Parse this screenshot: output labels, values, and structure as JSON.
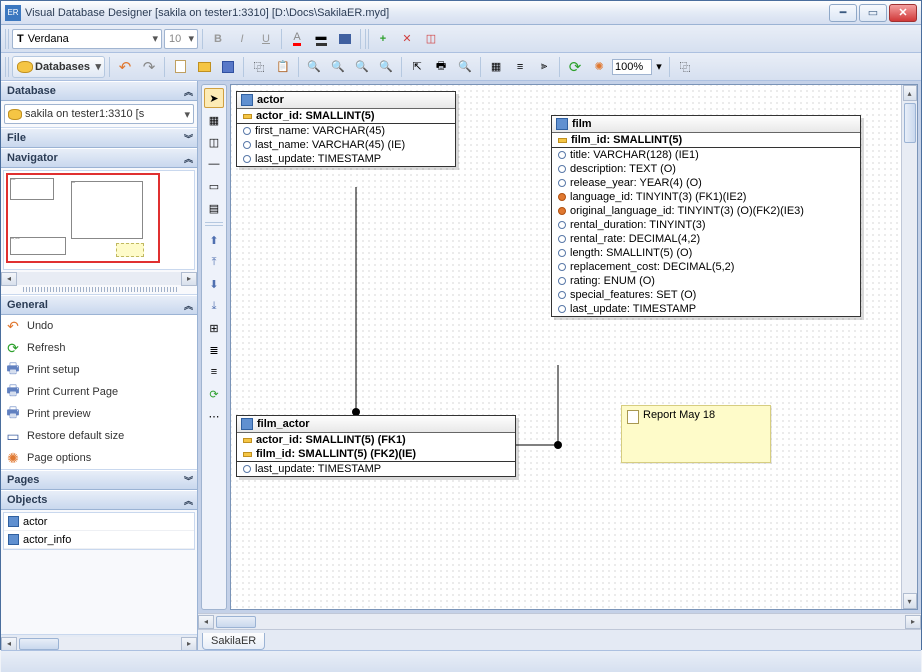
{
  "window": {
    "title": "Visual Database Designer [sakila on tester1:3310] [D:\\Docs\\SakilaER.myd]"
  },
  "toolbar1": {
    "font": "Verdana",
    "size": "10",
    "zoom": "100%"
  },
  "toolbar2": {
    "databases_label": "Databases"
  },
  "panels": {
    "database": {
      "title": "Database",
      "connection": "sakila on tester1:3310 [s"
    },
    "file": {
      "title": "File"
    },
    "navigator": {
      "title": "Navigator"
    },
    "general": {
      "title": "General",
      "items": [
        {
          "label": "Undo",
          "icon": "undo-icon",
          "color": "#E07830"
        },
        {
          "label": "Refresh",
          "icon": "refresh-icon",
          "color": "#2DA02D"
        },
        {
          "label": "Print setup",
          "icon": "print-setup-icon",
          "color": "#6080C0"
        },
        {
          "label": "Print Current Page",
          "icon": "print-page-icon",
          "color": "#6080C0"
        },
        {
          "label": "Print preview",
          "icon": "print-preview-icon",
          "color": "#6080C0"
        },
        {
          "label": "Restore default size",
          "icon": "restore-size-icon",
          "color": "#4060A0"
        },
        {
          "label": "Page options",
          "icon": "page-options-icon",
          "color": "#E07830"
        }
      ]
    },
    "pages": {
      "title": "Pages"
    },
    "objects": {
      "title": "Objects",
      "items": [
        "actor",
        "actor_info"
      ]
    }
  },
  "tables": {
    "actor": {
      "name": "actor",
      "columns": [
        {
          "text": "actor_id: SMALLINT(5)",
          "kind": "pk"
        },
        {
          "text": "first_name: VARCHAR(45)",
          "kind": "col"
        },
        {
          "text": "last_name: VARCHAR(45) (IE)",
          "kind": "col"
        },
        {
          "text": "last_update: TIMESTAMP",
          "kind": "col"
        }
      ]
    },
    "film_actor": {
      "name": "film_actor",
      "columns": [
        {
          "text": "actor_id: SMALLINT(5) (FK1)",
          "kind": "pk"
        },
        {
          "text": "film_id: SMALLINT(5) (FK2)(IE)",
          "kind": "pkfk"
        },
        {
          "text": "last_update: TIMESTAMP",
          "kind": "col"
        }
      ]
    },
    "film": {
      "name": "film",
      "columns": [
        {
          "text": "film_id: SMALLINT(5)",
          "kind": "pk"
        },
        {
          "text": "title: VARCHAR(128) (IE1)",
          "kind": "col"
        },
        {
          "text": "description: TEXT (O)",
          "kind": "col"
        },
        {
          "text": "release_year: YEAR(4) (O)",
          "kind": "col"
        },
        {
          "text": "language_id: TINYINT(3) (FK1)(IE2)",
          "kind": "fk"
        },
        {
          "text": "original_language_id: TINYINT(3) (O)(FK2)(IE3)",
          "kind": "fk"
        },
        {
          "text": "rental_duration: TINYINT(3)",
          "kind": "col"
        },
        {
          "text": "rental_rate: DECIMAL(4,2)",
          "kind": "col"
        },
        {
          "text": "length: SMALLINT(5) (O)",
          "kind": "col"
        },
        {
          "text": "replacement_cost: DECIMAL(5,2)",
          "kind": "col"
        },
        {
          "text": "rating: ENUM (O)",
          "kind": "col"
        },
        {
          "text": "special_features: SET (O)",
          "kind": "col"
        },
        {
          "text": "last_update: TIMESTAMP",
          "kind": "col"
        }
      ]
    }
  },
  "note": {
    "text": "Report May 18"
  },
  "page_tab": "SakilaER"
}
